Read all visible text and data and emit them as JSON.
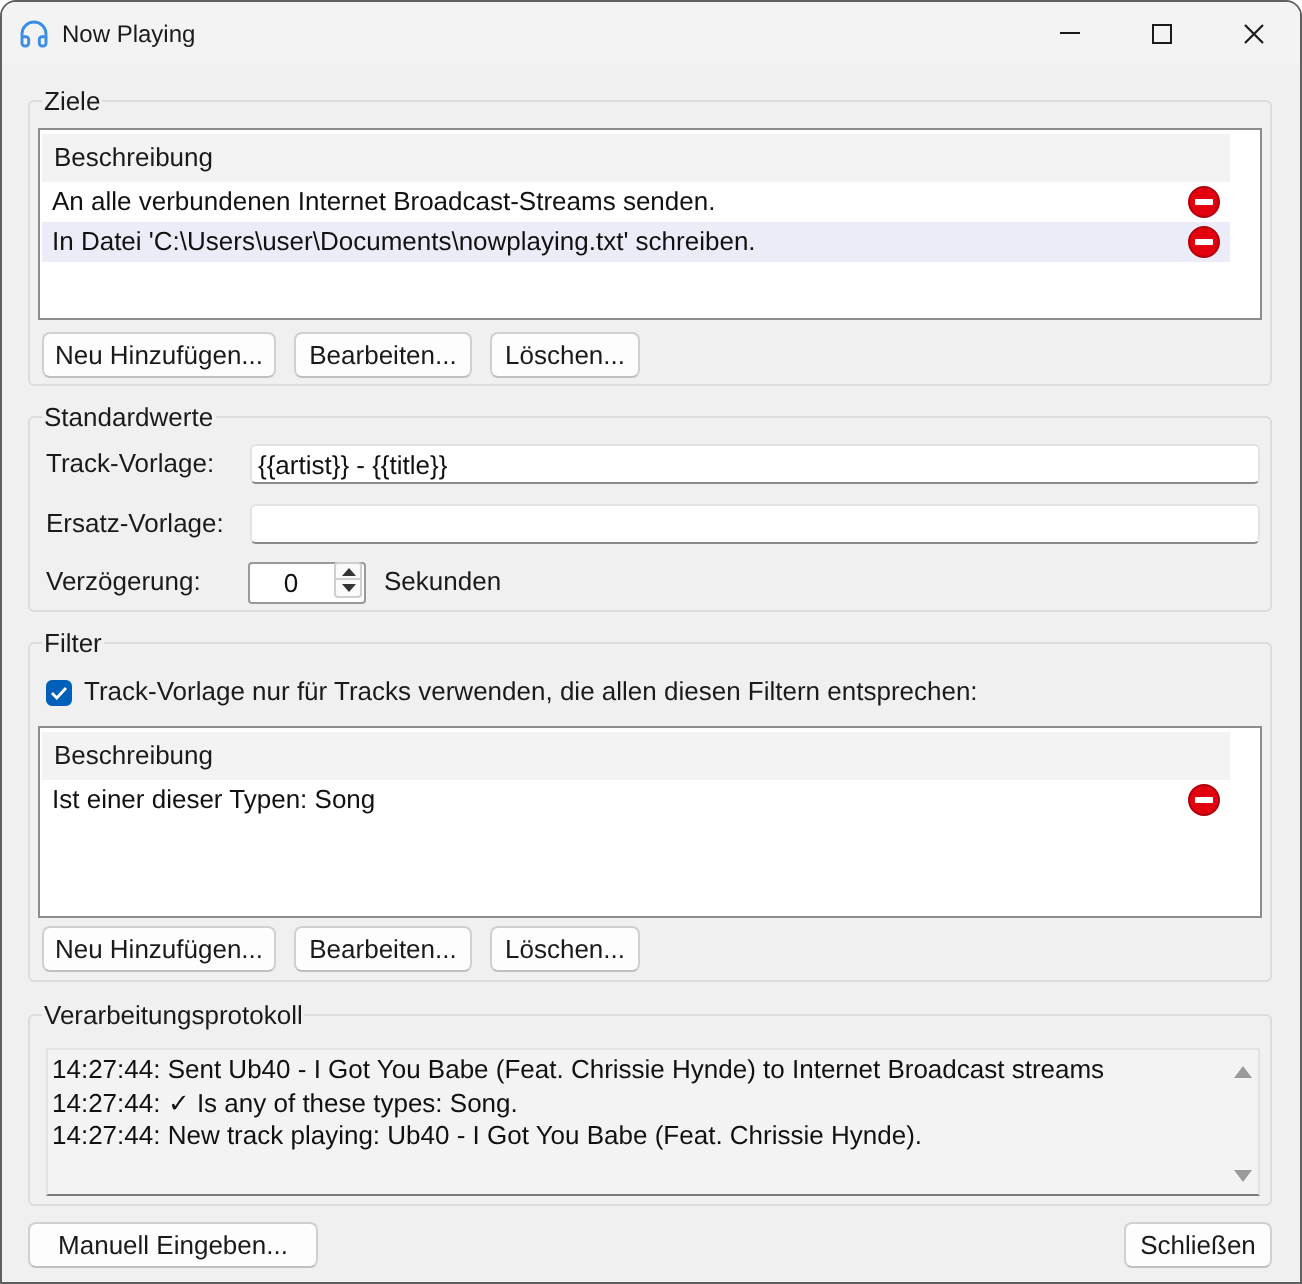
{
  "window": {
    "title": "Now Playing"
  },
  "targets": {
    "legend": "Ziele",
    "column": "Beschreibung",
    "rows": [
      {
        "text": "An alle verbundenen Internet Broadcast-Streams senden.",
        "selected": false
      },
      {
        "text": "In Datei 'C:\\Users\\user\\Documents\\nowplaying.txt' schreiben.",
        "selected": true
      }
    ],
    "buttons": [
      "Neu Hinzufügen...",
      "Bearbeiten...",
      "Löschen..."
    ]
  },
  "defaults": {
    "legend": "Standardwerte",
    "fields": [
      {
        "label": "Track-Vorlage:",
        "value": "{{artist}} - {{title}}"
      },
      {
        "label": "Ersatz-Vorlage:"
      }
    ],
    "delay": {
      "label": "Verzögerung:",
      "value": "0",
      "unit": "Sekunden"
    }
  },
  "filter": {
    "legend": "Filter",
    "checkbox": {
      "label": "Track-Vorlage nur für Tracks verwenden, die allen diesen Filtern entsprechen:",
      "checked": true
    },
    "column": "Beschreibung",
    "rows": [
      {
        "text": "Ist einer dieser Typen: Song",
        "selected": false
      }
    ],
    "buttons": [
      "Neu Hinzufügen...",
      "Bearbeiten...",
      "Löschen..."
    ]
  },
  "log": {
    "legend": "Verarbeitungsprotokoll",
    "lines": [
      "14:27:44: Sent Ub40 - I Got You Babe (Feat. Chrissie Hynde) to Internet Broadcast streams",
      "14:27:44: ✓ Is any of these types: Song.",
      "14:27:44: New track playing: Ub40 - I Got You Babe (Feat. Chrissie Hynde)."
    ]
  },
  "buttons": [
    "Manuell Eingeben...",
    "Schließen"
  ]
}
